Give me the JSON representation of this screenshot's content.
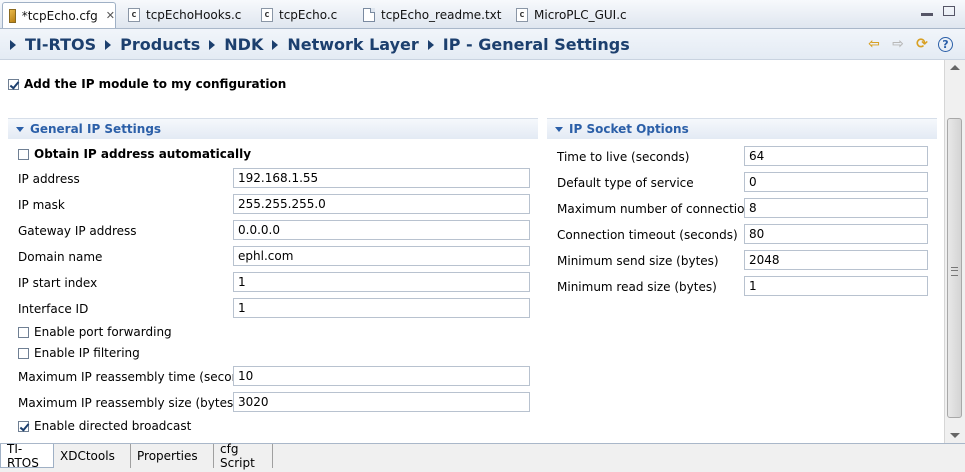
{
  "editor_tabs": [
    {
      "label": "*tcpEcho.cfg",
      "icon": "cfg-file-icon",
      "active": true,
      "closable": true
    },
    {
      "label": "tcpEchoHooks.c",
      "icon": "c-file-icon",
      "active": false
    },
    {
      "label": "tcpEcho.c",
      "icon": "c-file-icon",
      "active": false
    },
    {
      "label": "tcpEcho_readme.txt",
      "icon": "text-file-icon",
      "active": false
    },
    {
      "label": "MicroPLC_GUI.c",
      "icon": "c-file-icon",
      "active": false
    }
  ],
  "breadcrumb": [
    "TI-RTOS",
    "Products",
    "NDK",
    "Network Layer",
    "IP - General Settings"
  ],
  "add_module": {
    "label": "Add the IP module to my configuration",
    "checked": true
  },
  "general": {
    "title": "General IP Settings",
    "obtain_auto": {
      "label": "Obtain IP address automatically",
      "checked": false
    },
    "fields": [
      {
        "label": "IP address",
        "value": "192.168.1.55"
      },
      {
        "label": "IP mask",
        "value": "255.255.255.0"
      },
      {
        "label": "Gateway IP address",
        "value": "0.0.0.0"
      },
      {
        "label": "Domain name",
        "value": "ephl.com"
      },
      {
        "label": "IP start index",
        "value": "1"
      },
      {
        "label": "Interface ID",
        "value": "1"
      }
    ],
    "port_forwarding": {
      "label": "Enable port forwarding",
      "checked": false
    },
    "ip_filtering": {
      "label": "Enable IP filtering",
      "checked": false
    },
    "reassembly": [
      {
        "label": "Maximum IP reassembly time (seconds)",
        "value": "10"
      },
      {
        "label": "Maximum IP reassembly size (bytes)",
        "value": "3020"
      }
    ],
    "directed_broadcast": {
      "label": "Enable directed broadcast",
      "checked": true
    }
  },
  "socket": {
    "title": "IP Socket Options",
    "fields": [
      {
        "label": "Time to live (seconds)",
        "value": "64"
      },
      {
        "label": "Default type of service",
        "value": "0"
      },
      {
        "label": "Maximum number of connections",
        "value": "8"
      },
      {
        "label": "Connection timeout (seconds)",
        "value": "80"
      },
      {
        "label": "Minimum send size (bytes)",
        "value": "2048"
      },
      {
        "label": "Minimum read size (bytes)",
        "value": "1"
      }
    ]
  },
  "bottom_tabs": [
    {
      "label": "TI-RTOS",
      "active": true
    },
    {
      "label": "XDCtools",
      "active": false
    },
    {
      "label": "Properties",
      "active": false
    },
    {
      "label": "cfg Script",
      "active": false
    }
  ]
}
